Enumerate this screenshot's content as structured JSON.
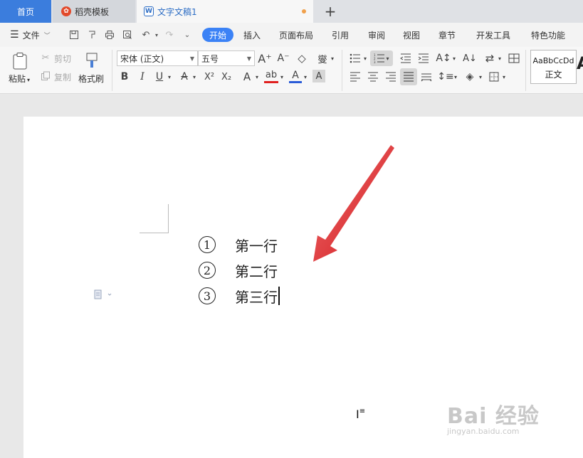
{
  "tabs": {
    "home": "首页",
    "templates": "稻壳模板",
    "document": "文字文稿1",
    "doc_icon": "W",
    "add": "+"
  },
  "menu": {
    "file": "文件",
    "items": [
      "开始",
      "插入",
      "页面布局",
      "引用",
      "审阅",
      "视图",
      "章节",
      "开发工具",
      "特色功能"
    ]
  },
  "ribbon": {
    "paste": "粘贴",
    "cut": "剪切",
    "copy": "复制",
    "format_painter": "格式刷",
    "font_name": "宋体 (正文)",
    "font_size": "五号",
    "pinyin": "燮",
    "style_preview": "AaBbCcDd",
    "style_name": "正文",
    "style_next": "A"
  },
  "document": {
    "lines": [
      {
        "num": "1",
        "text": "第一行"
      },
      {
        "num": "2",
        "text": "第二行"
      },
      {
        "num": "3",
        "text": "第三行"
      }
    ]
  },
  "watermark": {
    "main": "Bai 经验",
    "sub": "jingyan.baidu.com"
  },
  "colors": {
    "accent": "#3b82f6",
    "home_tab": "#3b7ddd",
    "arrow": "#e0201f"
  }
}
